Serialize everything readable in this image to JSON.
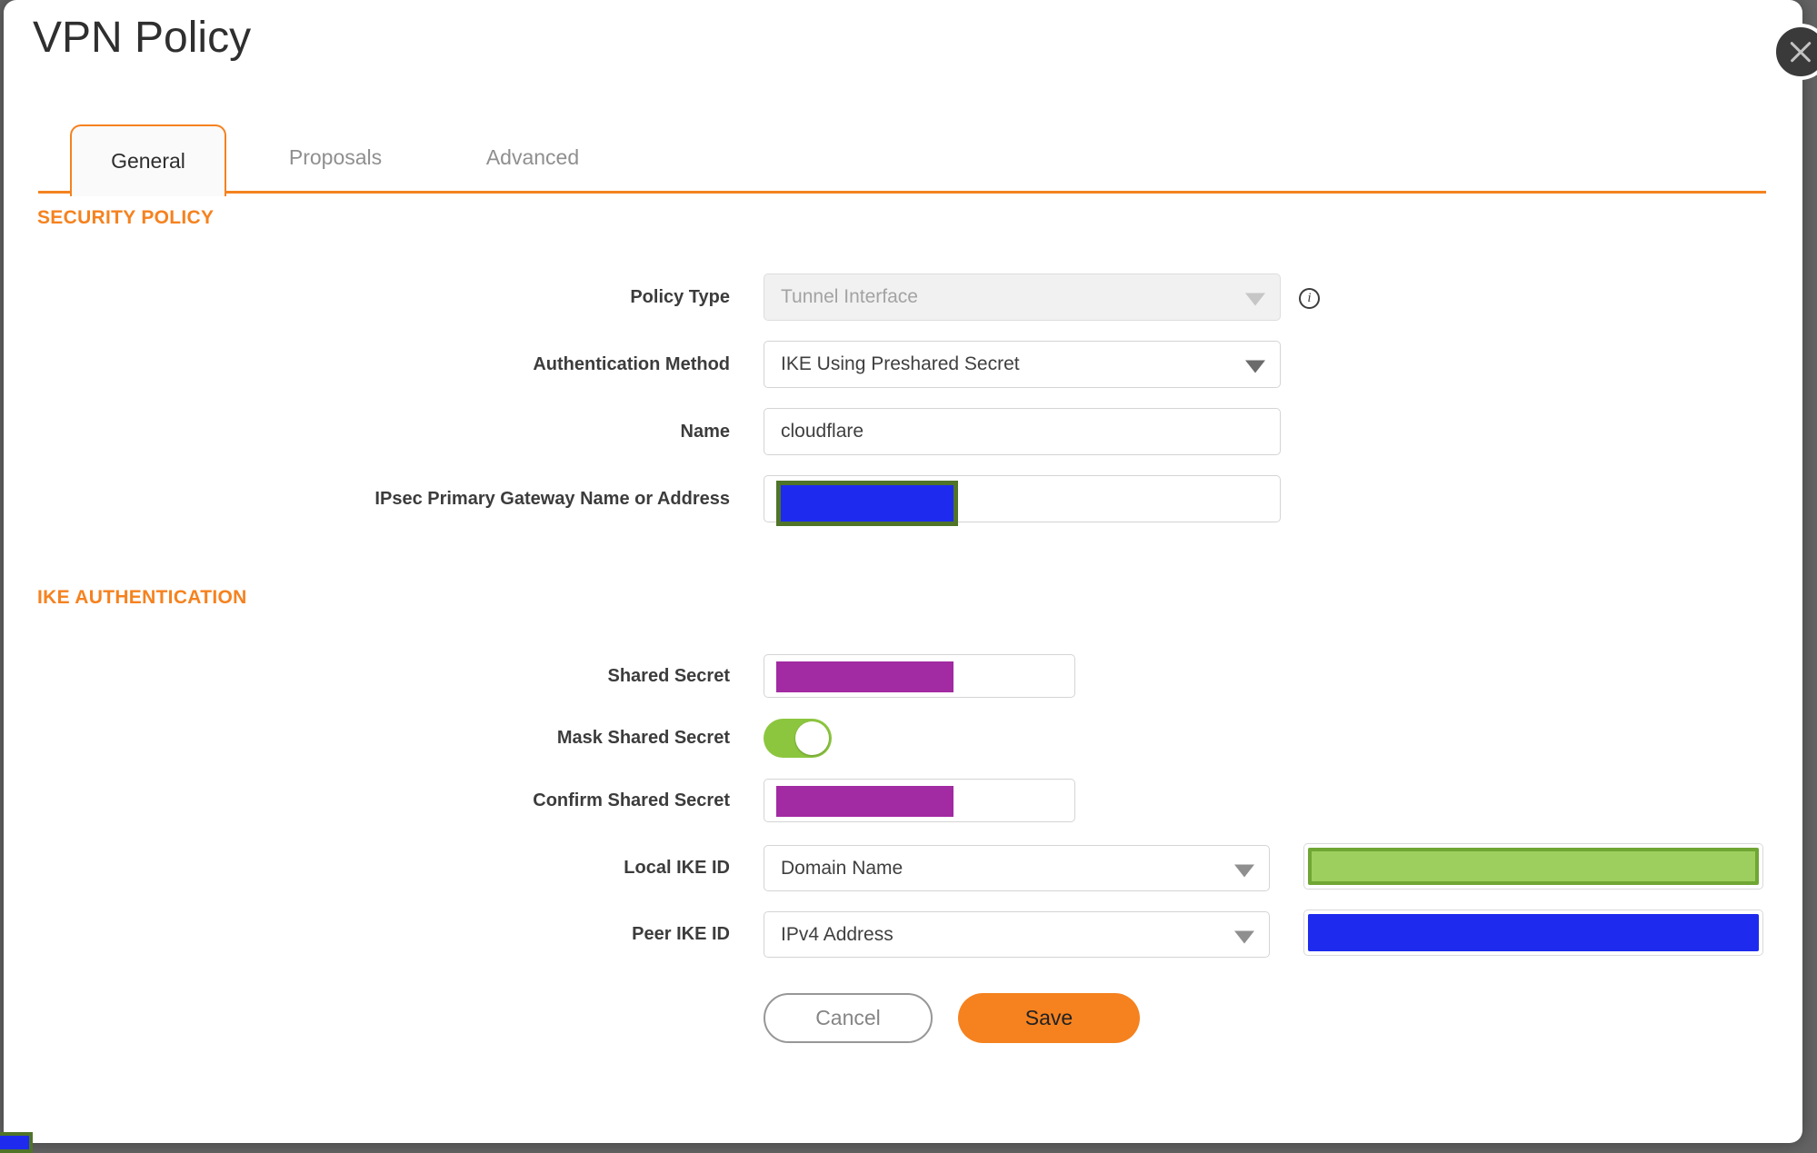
{
  "dialog": {
    "title": "VPN Policy"
  },
  "tabs": [
    {
      "label": "General",
      "active": true
    },
    {
      "label": "Proposals",
      "active": false
    },
    {
      "label": "Advanced",
      "active": false
    }
  ],
  "security_policy": {
    "heading": "SECURITY POLICY",
    "policy_type": {
      "label": "Policy Type",
      "value": "Tunnel Interface",
      "disabled": true
    },
    "authentication_method": {
      "label": "Authentication Method",
      "value": "IKE Using Preshared Secret"
    },
    "name": {
      "label": "Name",
      "value": "cloudflare"
    },
    "gateway": {
      "label": "IPsec Primary Gateway Name or Address",
      "value_redacted": true
    }
  },
  "ike_authentication": {
    "heading": "IKE AUTHENTICATION",
    "shared_secret": {
      "label": "Shared Secret",
      "value_redacted": true
    },
    "mask_shared_secret": {
      "label": "Mask Shared Secret",
      "enabled": true
    },
    "confirm_shared_secret": {
      "label": "Confirm Shared Secret",
      "value_redacted": true
    },
    "local_ike_id": {
      "label": "Local IKE ID",
      "value": "Domain Name",
      "value_redacted": true
    },
    "peer_ike_id": {
      "label": "Peer IKE ID",
      "value": "IPv4 Address",
      "value_redacted": true
    }
  },
  "buttons": {
    "cancel": "Cancel",
    "save": "Save"
  },
  "colors": {
    "accent_orange": "#F5821F",
    "redaction_purple": "#A22AA2",
    "redaction_blue": "#1E2BEE",
    "redaction_green_fill": "#9CCF5D",
    "redaction_green_border": "#70A634",
    "redaction_olive_border": "#507428",
    "toggle_green": "#8CC63F",
    "page_background": "#646464"
  }
}
